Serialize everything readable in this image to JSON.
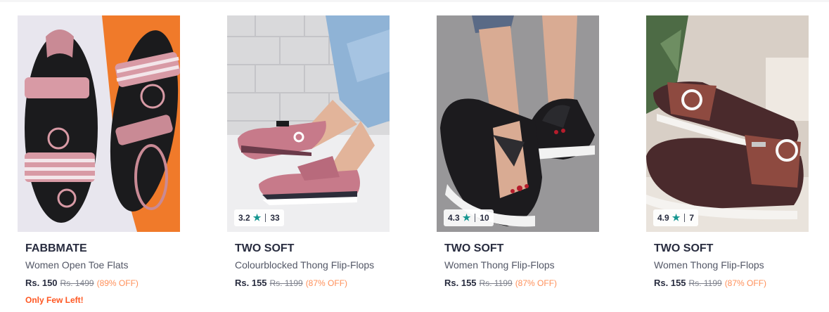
{
  "products": [
    {
      "brand": "FABBMATE",
      "name": "Women Open Toe Flats",
      "price": "Rs. 150",
      "mrp": "Rs. 1499",
      "discount": "(89% OFF)",
      "stock_note": "Only Few Left!",
      "image_icon": "sandal-image"
    },
    {
      "brand": "TWO SOFT",
      "name": "Colourblocked Thong Flip-Flops",
      "price": "Rs. 155",
      "mrp": "Rs. 1199",
      "discount": "(87% OFF)",
      "rating": "3.2",
      "rating_count": "33",
      "image_icon": "flip-flop-image"
    },
    {
      "brand": "TWO SOFT",
      "name": "Women Thong Flip-Flops",
      "price": "Rs. 155",
      "mrp": "Rs. 1199",
      "discount": "(87% OFF)",
      "rating": "4.3",
      "rating_count": "10",
      "image_icon": "platform-flip-flop-image"
    },
    {
      "brand": "TWO SOFT",
      "name": "Women Thong Flip-Flops",
      "price": "Rs. 155",
      "mrp": "Rs. 1199",
      "discount": "(87% OFF)",
      "rating": "4.9",
      "rating_count": "7",
      "image_icon": "flip-flop-image"
    }
  ],
  "colors": {
    "star": "#14958f",
    "discount": "#ff905a",
    "stock_note": "#ff5722",
    "brand_text": "#282c3f"
  }
}
